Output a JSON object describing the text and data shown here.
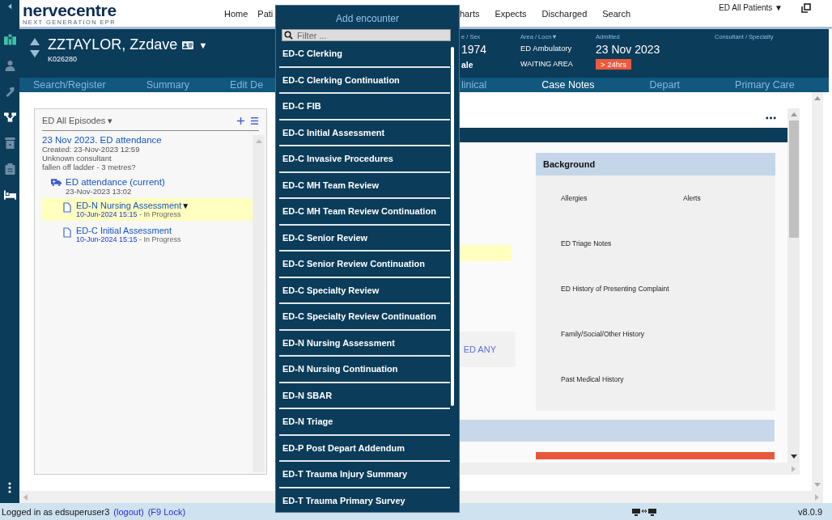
{
  "header": {
    "logo": {
      "name": "nervecentre",
      "tagline": "NEXT GENERATION EPR"
    },
    "nav": [
      {
        "label": "Home"
      },
      {
        "label": "Pati"
      },
      {
        "label": "harts"
      },
      {
        "label": "Expects"
      },
      {
        "label": "Discharged"
      },
      {
        "label": "Search"
      }
    ],
    "patient_list": {
      "label": "ED All Patients",
      "caret": "▼"
    }
  },
  "patient": {
    "name": "ZZTAYLOR, Zzdave",
    "caret": "▼",
    "id": "K026280",
    "fields": [
      {
        "kind": "date",
        "label": "e / Sex",
        "value": "1974",
        "value_2": "ale"
      },
      {
        "kind": "location",
        "label": "Area / Locn",
        "caret": "▼",
        "value": "ED Ambulatory",
        "value_2": "WAITING AREA"
      },
      {
        "kind": "date",
        "label": "Admitted",
        "value": "23 Nov 2023",
        "badge": "> 24hrs"
      },
      {
        "label": "Consultant / Specialty"
      }
    ]
  },
  "tabs": [
    {
      "label": "Search/Register",
      "selected": false
    },
    {
      "label": "Summary",
      "selected": false
    },
    {
      "label": "Edit De",
      "selected": false
    },
    {
      "label": "linical",
      "selected": false
    },
    {
      "label": "Case Notes",
      "selected": true
    },
    {
      "label": "Depart",
      "selected": false
    },
    {
      "label": "Primary Care",
      "selected": false
    }
  ],
  "episodes_panel": {
    "title": "ED All Episodes",
    "caret": "▾",
    "episodes": [
      {
        "title": "23 Nov 2023. ED attendance",
        "created": "Created: 23-Nov-2023 12:59",
        "consultant": "Unknown consultant",
        "note": "fallen off ladder - 3 metres?",
        "children": [
          {
            "title": "ED attendance (current)",
            "date": "23-Nov-2023 13:02",
            "children": [
              {
                "title": "ED-N Nursing Assessment",
                "caret": "▼",
                "date": "10-Jun-2024 15:15",
                "status": "- In Progress",
                "selected": true
              },
              {
                "title": "ED-C Initial Assessment",
                "date": "10-Jun-2024 15:15",
                "status": "- In Progress",
                "selected": false
              }
            ]
          }
        ]
      }
    ]
  },
  "document": {
    "fragment": "ED ANY",
    "background": {
      "title": "Background",
      "fields": [
        "Allergies",
        "Alerts",
        "ED Triage Notes",
        "ED History of Presenting Complaint",
        "Family/Social/Other History",
        "Past Medical History"
      ]
    }
  },
  "add_encounter": {
    "title": "Add encounter",
    "filter": {
      "placeholder": "Filter ..."
    },
    "items": [
      {
        "label": "ED-C Clerking"
      },
      {
        "label": "ED-C Clerking Continuation"
      },
      {
        "label": "ED-C FIB"
      },
      {
        "label": "ED-C Initial Assessment"
      },
      {
        "label": "ED-C Invasive Procedures"
      },
      {
        "label": "ED-C MH Team Review"
      },
      {
        "label": "ED-C MH Team Review Continuation"
      },
      {
        "label": "ED-C Senior Review"
      },
      {
        "label": "ED-C Senior Review Continuation"
      },
      {
        "label": "ED-C Specialty Review"
      },
      {
        "label": "ED-C Specialty Review Continuation"
      },
      {
        "label": "ED-N Nursing Assessment"
      },
      {
        "label": "ED-N Nursing Continuation"
      },
      {
        "label": "ED-N SBAR"
      },
      {
        "label": "ED-N Triage"
      },
      {
        "label": "ED-P Post Depart Addendum"
      },
      {
        "label": "ED-T Trauma Injury Summary"
      },
      {
        "label": "ED-T Trauma Primary Survey"
      }
    ]
  },
  "status_bar": {
    "user_text": "Logged in as edsuperuser3",
    "links": [
      "(logout)",
      "(F9 Lock)"
    ],
    "version": "v8.0.9"
  }
}
